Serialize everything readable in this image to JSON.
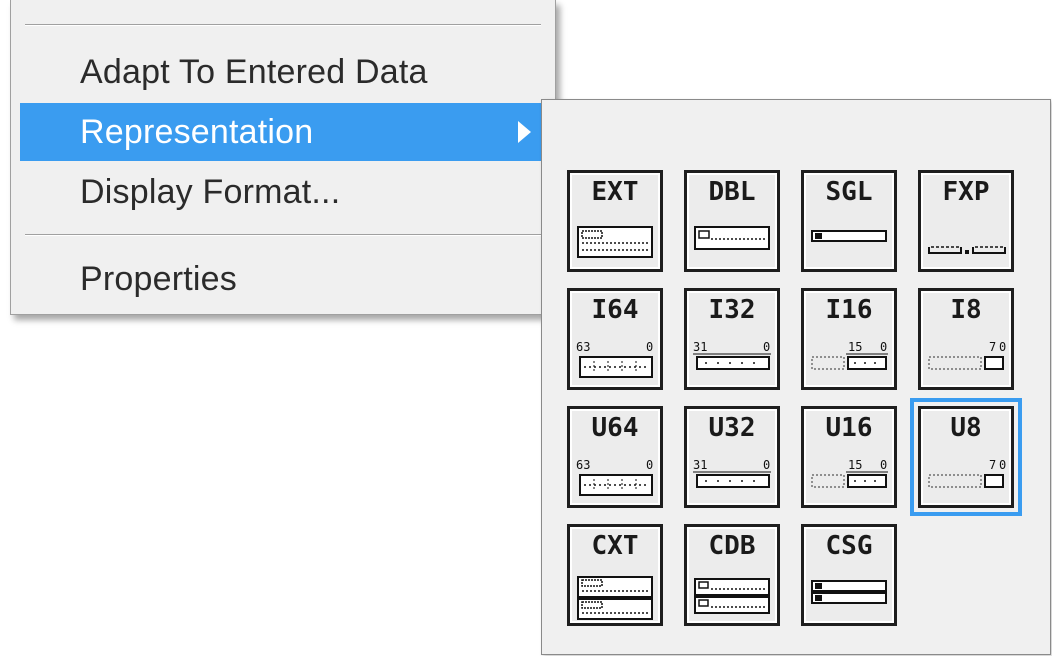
{
  "menu": {
    "items": [
      {
        "label": "Adapt To Entered Data"
      },
      {
        "label": "Representation",
        "submenu": true,
        "selected": true
      },
      {
        "label": "Display Format..."
      },
      {
        "label": "Properties"
      }
    ]
  },
  "palette": {
    "rows": [
      [
        {
          "label": "EXT",
          "icon": "float-extended-icon"
        },
        {
          "label": "DBL",
          "icon": "float-double-icon"
        },
        {
          "label": "SGL",
          "icon": "float-single-icon"
        },
        {
          "label": "FXP",
          "icon": "fixed-point-icon"
        }
      ],
      [
        {
          "label": "I64",
          "icon": "int64-icon",
          "hi": "63",
          "lo": "0"
        },
        {
          "label": "I32",
          "icon": "int32-icon",
          "hi": "31",
          "lo": "0"
        },
        {
          "label": "I16",
          "icon": "int16-icon",
          "hi": "15",
          "lo": "0"
        },
        {
          "label": "I8",
          "icon": "int8-icon",
          "hi": "7",
          "lo": "0"
        }
      ],
      [
        {
          "label": "U64",
          "icon": "uint64-icon",
          "hi": "63",
          "lo": "0"
        },
        {
          "label": "U32",
          "icon": "uint32-icon",
          "hi": "31",
          "lo": "0"
        },
        {
          "label": "U16",
          "icon": "uint16-icon",
          "hi": "15",
          "lo": "0"
        },
        {
          "label": "U8",
          "icon": "uint8-icon",
          "hi": "7",
          "lo": "0",
          "selected": true
        }
      ],
      [
        {
          "label": "CXT",
          "icon": "complex-extended-icon"
        },
        {
          "label": "CDB",
          "icon": "complex-double-icon"
        },
        {
          "label": "CSG",
          "icon": "complex-single-icon"
        }
      ]
    ]
  },
  "colors": {
    "highlight": "#3a9cf0",
    "menu_bg": "#f0f0f0",
    "tile_border": "#1e1e1e"
  }
}
